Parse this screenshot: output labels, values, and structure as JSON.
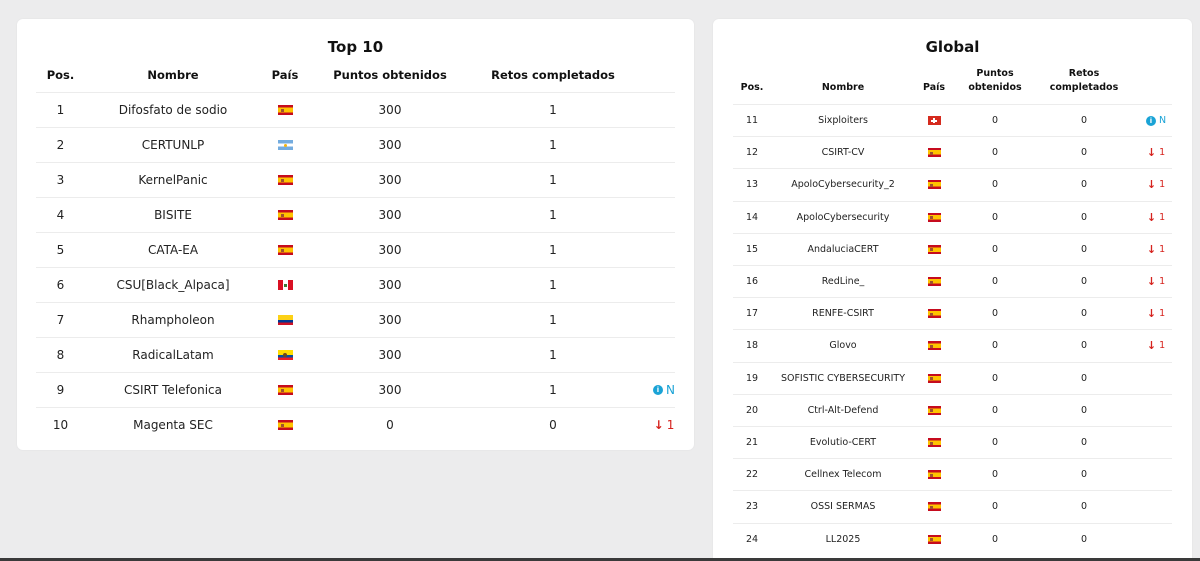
{
  "top10": {
    "title": "Top 10",
    "headers": [
      "Pos.",
      "Nombre",
      "País",
      "Puntos obtenidos",
      "Retos completados"
    ],
    "rows": [
      {
        "pos": "1",
        "name": "Difosfato de sodio",
        "country": "es",
        "points": "300",
        "challenges": "1",
        "status": ""
      },
      {
        "pos": "2",
        "name": "CERTUNLP",
        "country": "ar",
        "points": "300",
        "challenges": "1",
        "status": ""
      },
      {
        "pos": "3",
        "name": "KernelPanic",
        "country": "es",
        "points": "300",
        "challenges": "1",
        "status": ""
      },
      {
        "pos": "4",
        "name": "BISITE",
        "country": "es",
        "points": "300",
        "challenges": "1",
        "status": ""
      },
      {
        "pos": "5",
        "name": "CATA-EA",
        "country": "es",
        "points": "300",
        "challenges": "1",
        "status": ""
      },
      {
        "pos": "6",
        "name": "CSU[Black_Alpaca]",
        "country": "pe",
        "points": "300",
        "challenges": "1",
        "status": ""
      },
      {
        "pos": "7",
        "name": "Rhampholeon",
        "country": "co",
        "points": "300",
        "challenges": "1",
        "status": ""
      },
      {
        "pos": "8",
        "name": "RadicalLatam",
        "country": "ec",
        "points": "300",
        "challenges": "1",
        "status": ""
      },
      {
        "pos": "9",
        "name": "CSIRT Telefonica",
        "country": "es",
        "points": "300",
        "challenges": "1",
        "status": "new",
        "status_text": "N"
      },
      {
        "pos": "10",
        "name": "Magenta SEC",
        "country": "es",
        "points": "0",
        "challenges": "0",
        "status": "down",
        "status_text": "1"
      }
    ]
  },
  "global": {
    "title": "Global",
    "headers": {
      "pos": "Pos.",
      "name": "Nombre",
      "country": "País",
      "points_line1": "Puntos",
      "points_line2": "obtenidos",
      "challenges_line1": "Retos",
      "challenges_line2": "completados"
    },
    "rows": [
      {
        "pos": "11",
        "name": "Sixploiters",
        "country": "ch",
        "points": "0",
        "challenges": "0",
        "status": "new",
        "status_text": "N"
      },
      {
        "pos": "12",
        "name": "CSIRT-CV",
        "country": "es",
        "points": "0",
        "challenges": "0",
        "status": "down",
        "status_text": "1"
      },
      {
        "pos": "13",
        "name": "ApoloCybersecurity_2",
        "country": "es",
        "points": "0",
        "challenges": "0",
        "status": "down",
        "status_text": "1"
      },
      {
        "pos": "14",
        "name": "ApoloCybersecurity",
        "country": "es",
        "points": "0",
        "challenges": "0",
        "status": "down",
        "status_text": "1"
      },
      {
        "pos": "15",
        "name": "AndaluciaCERT",
        "country": "es",
        "points": "0",
        "challenges": "0",
        "status": "down",
        "status_text": "1"
      },
      {
        "pos": "16",
        "name": "RedLine_",
        "country": "es",
        "points": "0",
        "challenges": "0",
        "status": "down",
        "status_text": "1"
      },
      {
        "pos": "17",
        "name": "RENFE-CSIRT",
        "country": "es",
        "points": "0",
        "challenges": "0",
        "status": "down",
        "status_text": "1"
      },
      {
        "pos": "18",
        "name": "Glovo",
        "country": "es",
        "points": "0",
        "challenges": "0",
        "status": "down",
        "status_text": "1"
      },
      {
        "pos": "19",
        "name": "SOFISTIC CYBERSECURITY",
        "country": "es",
        "points": "0",
        "challenges": "0",
        "status": ""
      },
      {
        "pos": "20",
        "name": "Ctrl-Alt-Defend",
        "country": "es",
        "points": "0",
        "challenges": "0",
        "status": ""
      },
      {
        "pos": "21",
        "name": "Evolutio-CERT",
        "country": "es",
        "points": "0",
        "challenges": "0",
        "status": ""
      },
      {
        "pos": "22",
        "name": "Cellnex Telecom",
        "country": "es",
        "points": "0",
        "challenges": "0",
        "status": ""
      },
      {
        "pos": "23",
        "name": "OSSI SERMAS",
        "country": "es",
        "points": "0",
        "challenges": "0",
        "status": ""
      },
      {
        "pos": "24",
        "name": "LL2025",
        "country": "es",
        "points": "0",
        "challenges": "0",
        "status": ""
      }
    ]
  },
  "colors": {
    "new": "#1aa3d6",
    "down": "#d6231e"
  }
}
